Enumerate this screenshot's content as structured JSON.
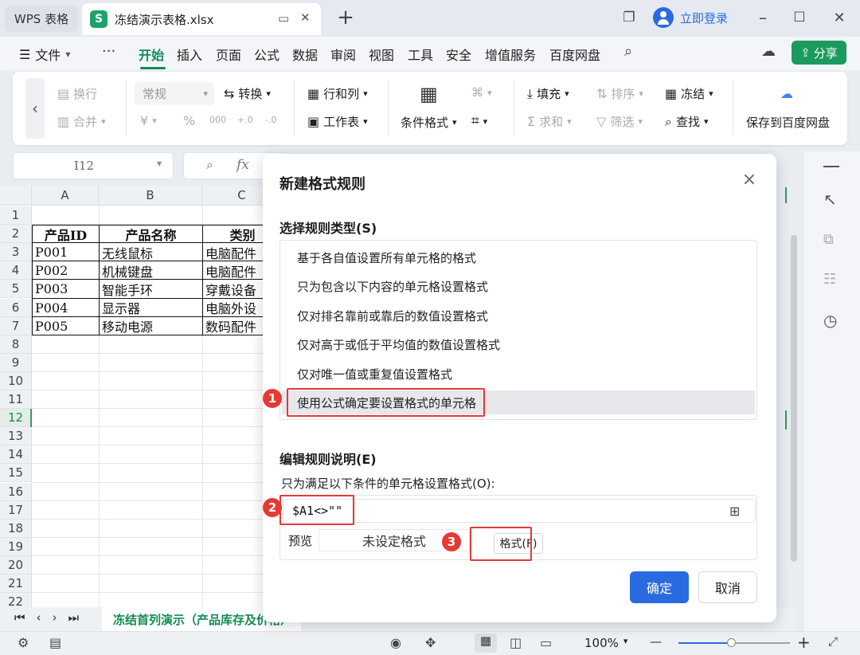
{
  "titlebar": {
    "app_tab": "WPS 表格",
    "file_tab": "冻结演示表格.xlsx",
    "login": "立即登录",
    "new_tab": "+",
    "logo_letter": "S"
  },
  "menu": {
    "file": "文件",
    "items": [
      "开始",
      "插入",
      "页面",
      "公式",
      "数据",
      "审阅",
      "视图",
      "工具",
      "安全",
      "增值服务",
      "百度网盘"
    ],
    "share": "分享"
  },
  "ribbon": {
    "wrap": "换行",
    "merge": "合并",
    "number_format": "常规",
    "convert": "转换",
    "rows_cols": "行和列",
    "worksheet": "工作表",
    "cond_format": "条件格式",
    "fill": "填充",
    "sort": "排序",
    "freeze": "冻结",
    "sum": "求和",
    "filter": "筛选",
    "find": "查找",
    "save_baidu": "保存到百度网盘",
    "currency": "¥",
    "percent": "%",
    "thousands": "000",
    "dec_inc": "+.0",
    "dec_dec": "-.0"
  },
  "formula_bar": {
    "cell_ref": "I12",
    "fx": "fx"
  },
  "sheet": {
    "columns": [
      "A",
      "B",
      "C"
    ],
    "rows": [
      "1",
      "2",
      "3",
      "4",
      "5",
      "6",
      "7",
      "8",
      "9",
      "10",
      "11",
      "12",
      "13",
      "14",
      "15",
      "16",
      "17",
      "18",
      "19",
      "20",
      "21",
      "22"
    ],
    "header": [
      "产品ID",
      "产品名称",
      "类别"
    ],
    "data": [
      [
        "P001",
        "无线鼠标",
        "电脑配件"
      ],
      [
        "P002",
        "机械键盘",
        "电脑配件"
      ],
      [
        "P003",
        "智能手环",
        "穿戴设备"
      ],
      [
        "P004",
        "显示器",
        "电脑外设"
      ],
      [
        "P005",
        "移动电源",
        "数码配件"
      ]
    ],
    "tab_name": "冻结首列演示（产品库存及价格）"
  },
  "statusbar": {
    "zoom": "100%",
    "minus": "—",
    "plus": "+"
  },
  "dialog": {
    "title": "新建格式规则",
    "rule_type_label": "选择规则类型(S)",
    "rules": [
      "基于各自值设置所有单元格的格式",
      "只为包含以下内容的单元格设置格式",
      "仅对排名靠前或靠后的数值设置格式",
      "仅对高于或低于平均值的数值设置格式",
      "仅对唯一值或重复值设置格式",
      "使用公式确定要设置格式的单元格"
    ],
    "edit_label": "编辑规则说明(E)",
    "condition_label": "只为满足以下条件的单元格设置格式(O):",
    "formula": "$A1<>\"\"",
    "preview_label": "预览",
    "preview_text": "未设定格式",
    "format_button": "格式(F)",
    "ok": "确定",
    "cancel": "取消",
    "markers": [
      "1",
      "2",
      "3"
    ]
  },
  "colors": {
    "accent_green": "#148b55",
    "primary_blue": "#2a6ae0",
    "highlight_red": "#e53935"
  }
}
